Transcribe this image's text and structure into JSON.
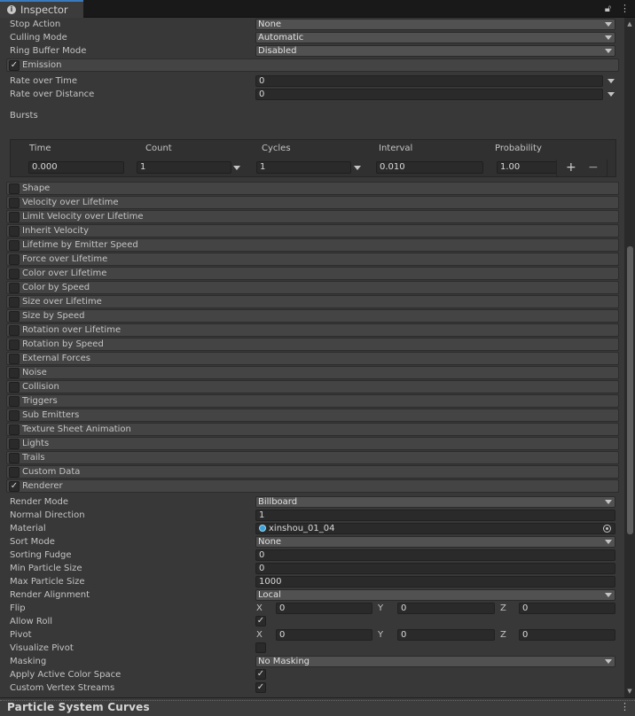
{
  "window": {
    "tab_title": "Inspector",
    "lock_icon": "lock-icon",
    "menu_icon": "kebab-menu-icon"
  },
  "main_settings": [
    {
      "label": "Stop Action",
      "value": "None"
    },
    {
      "label": "Culling Mode",
      "value": "Automatic"
    },
    {
      "label": "Ring Buffer Mode",
      "value": "Disabled"
    }
  ],
  "emission": {
    "label": "Emission",
    "enabled": true,
    "rate_over_time_label": "Rate over Time",
    "rate_over_time": "0",
    "rate_over_distance_label": "Rate over Distance",
    "rate_over_distance": "0",
    "bursts_label": "Bursts",
    "bursts_columns": [
      "Time",
      "Count",
      "Cycles",
      "Interval",
      "Probability"
    ],
    "bursts_rows": [
      {
        "time": "0.000",
        "count": "1",
        "cycles": "1",
        "interval": "0.010",
        "probability": "1.00"
      }
    ],
    "add_symbol": "+",
    "remove_symbol": "−"
  },
  "modules": [
    {
      "label": "Shape",
      "enabled": false
    },
    {
      "label": "Velocity over Lifetime",
      "enabled": false
    },
    {
      "label": "Limit Velocity over Lifetime",
      "enabled": false
    },
    {
      "label": "Inherit Velocity",
      "enabled": false
    },
    {
      "label": "Lifetime by Emitter Speed",
      "enabled": false
    },
    {
      "label": "Force over Lifetime",
      "enabled": false
    },
    {
      "label": "Color over Lifetime",
      "enabled": false
    },
    {
      "label": "Color by Speed",
      "enabled": false
    },
    {
      "label": "Size over Lifetime",
      "enabled": false
    },
    {
      "label": "Size by Speed",
      "enabled": false
    },
    {
      "label": "Rotation over Lifetime",
      "enabled": false
    },
    {
      "label": "Rotation by Speed",
      "enabled": false
    },
    {
      "label": "External Forces",
      "enabled": false
    },
    {
      "label": "Noise",
      "enabled": false
    },
    {
      "label": "Collision",
      "enabled": false
    },
    {
      "label": "Triggers",
      "enabled": false
    },
    {
      "label": "Sub Emitters",
      "enabled": false
    },
    {
      "label": "Texture Sheet Animation",
      "enabled": false
    },
    {
      "label": "Lights",
      "enabled": false
    },
    {
      "label": "Trails",
      "enabled": false
    },
    {
      "label": "Custom Data",
      "enabled": false
    },
    {
      "label": "Renderer",
      "enabled": true
    }
  ],
  "renderer": {
    "render_mode_label": "Render Mode",
    "render_mode": "Billboard",
    "normal_direction_label": "Normal Direction",
    "normal_direction": "1",
    "material_label": "Material",
    "material": "xinshou_01_04",
    "sort_mode_label": "Sort Mode",
    "sort_mode": "None",
    "sorting_fudge_label": "Sorting Fudge",
    "sorting_fudge": "0",
    "min_particle_size_label": "Min Particle Size",
    "min_particle_size": "0",
    "max_particle_size_label": "Max Particle Size",
    "max_particle_size": "1000",
    "render_alignment_label": "Render Alignment",
    "render_alignment": "Local",
    "flip_label": "Flip",
    "flip": {
      "x": "0",
      "y": "0",
      "z": "0"
    },
    "allow_roll_label": "Allow Roll",
    "allow_roll": true,
    "pivot_label": "Pivot",
    "pivot": {
      "x": "0",
      "y": "0",
      "z": "0"
    },
    "visualize_pivot_label": "Visualize Pivot",
    "visualize_pivot": false,
    "masking_label": "Masking",
    "masking": "No Masking",
    "apply_active_color_space_label": "Apply Active Color Space",
    "apply_active_color_space": true,
    "custom_vertex_streams_label": "Custom Vertex Streams",
    "custom_vertex_streams": true,
    "axis_labels": {
      "x": "X",
      "y": "Y",
      "z": "Z"
    }
  },
  "footer": {
    "title": "Particle System Curves"
  },
  "check_glyph": "✓"
}
